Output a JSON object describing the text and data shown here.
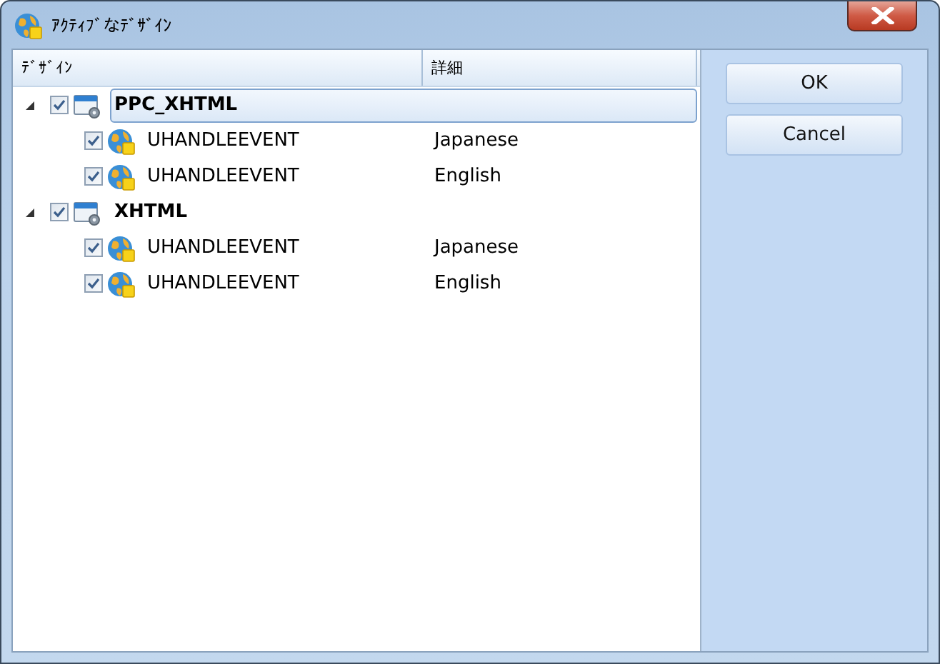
{
  "window": {
    "title": "ｱｸﾃｨﾌﾞなﾃﾞｻﾞｲﾝ"
  },
  "tree": {
    "columns": [
      "ﾃﾞｻﾞｲﾝ",
      "詳細"
    ],
    "items": [
      {
        "label": "PPC_XHTML",
        "checked": true,
        "expanded": true,
        "selected": true,
        "children": [
          {
            "label": "UHANDLEEVENT",
            "detail": "Japanese",
            "checked": true,
            "selected": false
          },
          {
            "label": "UHANDLEEVENT",
            "detail": "English",
            "checked": true,
            "selected": false
          }
        ]
      },
      {
        "label": "XHTML",
        "checked": true,
        "expanded": true,
        "selected": false,
        "children": [
          {
            "label": "UHANDLEEVENT",
            "detail": "Japanese",
            "checked": true,
            "selected": false
          },
          {
            "label": "UHANDLEEVENT",
            "detail": "English",
            "checked": true,
            "selected": false
          }
        ]
      }
    ]
  },
  "buttons": [
    "OK",
    "Cancel"
  ]
}
